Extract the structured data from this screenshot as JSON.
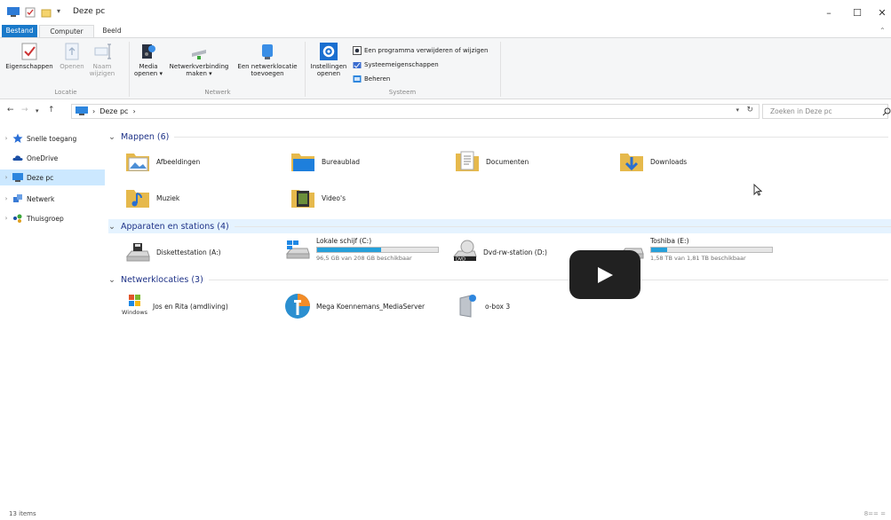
{
  "window": {
    "title": "Deze pc",
    "minimize_icon": "–",
    "maximize_icon": "☐",
    "close_icon": "✕"
  },
  "tabs": [
    "Bestand",
    "Computer",
    "Beeld"
  ],
  "ribbon": {
    "location": {
      "label": "Locatie",
      "properties": "Eigenschappen",
      "open": "Openen",
      "rename_1": "Naam",
      "rename_2": "wijzigen"
    },
    "network": {
      "label": "Netwerk",
      "media_1": "Media",
      "media_2": "openen ▾",
      "netconn_1": "Netwerkverbinding",
      "netconn_2": "maken ▾",
      "netloc_1": "Een netwerklocatie",
      "netloc_2": "toevoegen"
    },
    "system": {
      "label": "Systeem",
      "settings_1": "Instellingen",
      "settings_2": "openen",
      "uninstall": "Een programma verwijderen of wijzigen",
      "sysprops": "Systeemeigenschappen",
      "manage": "Beheren"
    }
  },
  "address": {
    "path": "Deze pc",
    "sep": "›",
    "search_placeholder": "Zoeken in Deze pc"
  },
  "nav": [
    {
      "label": "Snelle toegang",
      "icon": "star-icon",
      "color": "#2b6fd6"
    },
    {
      "label": "OneDrive",
      "icon": "cloud-icon",
      "color": "#1b4fa5"
    },
    {
      "label": "Deze pc",
      "icon": "monitor-icon",
      "color": "#2e86de"
    },
    {
      "label": "Netwerk",
      "icon": "network-icon",
      "color": "#3a7bd5"
    },
    {
      "label": "Thuisgroep",
      "icon": "homegroup-icon",
      "color": "#3aa63a"
    }
  ],
  "sections": {
    "folders": "Mappen (6)",
    "devices": "Apparaten en stations (4)",
    "netlocs": "Netwerklocaties (3)"
  },
  "folders": [
    {
      "label": "Afbeeldingen",
      "icon": "pictures-folder-icon"
    },
    {
      "label": "Bureaublad",
      "icon": "desktop-folder-icon"
    },
    {
      "label": "Documenten",
      "icon": "documents-folder-icon"
    },
    {
      "label": "Downloads",
      "icon": "downloads-folder-icon"
    },
    {
      "label": "Muziek",
      "icon": "music-folder-icon"
    },
    {
      "label": "Video's",
      "icon": "videos-folder-icon"
    }
  ],
  "drives": [
    {
      "label": "Diskettestation (A:)",
      "icon": "floppy-drive-icon"
    },
    {
      "label": "Lokale schijf (C:)",
      "icon": "system-drive-icon",
      "usage": 0.53,
      "sub": "96,5 GB van 208 GB beschikbaar"
    },
    {
      "label": "Dvd-rw-station (D:)",
      "icon": "dvd-drive-icon"
    },
    {
      "label": "Toshiba (E:)",
      "icon": "external-drive-icon",
      "usage": 0.13,
      "sub": "1,58 TB van 1,81 TB beschikbaar"
    }
  ],
  "netlocs": [
    {
      "label": "Jos en Rita (amdliving)",
      "icon": "windows-media-icon"
    },
    {
      "label": "Mega Koennemans_MediaServer",
      "icon": "media-server-icon"
    },
    {
      "label": "o-box 3",
      "icon": "network-device-icon"
    }
  ],
  "status": {
    "items": "13 items",
    "right": "8== ="
  },
  "colors": {
    "accent": "#1979ca",
    "selection": "#cce8ff",
    "section_text": "#1e3287",
    "drive_fill": "#26a0da"
  }
}
